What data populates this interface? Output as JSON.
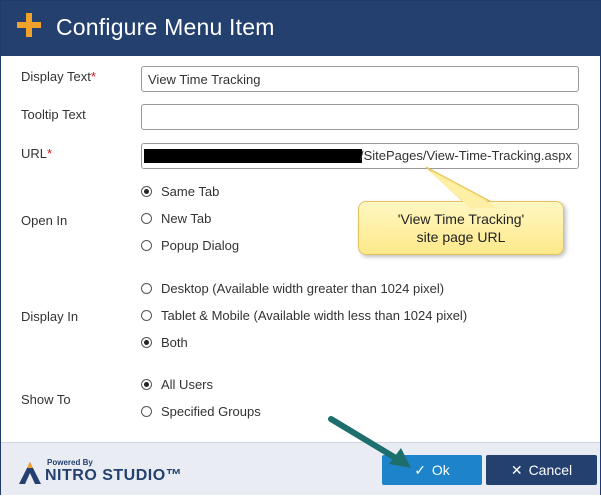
{
  "dialog": {
    "title": "Configure Menu Item"
  },
  "fields": {
    "display_text": {
      "label": "Display Text",
      "required_mark": "*",
      "value": "View Time Tracking"
    },
    "tooltip_text": {
      "label": "Tooltip Text",
      "value": ""
    },
    "url": {
      "label": "URL",
      "required_mark": "*",
      "visible_value": "/SitePages/View-Time-Tracking.aspx"
    }
  },
  "open_in": {
    "label": "Open In",
    "options": [
      {
        "label": "Same Tab",
        "selected": true
      },
      {
        "label": "New Tab",
        "selected": false
      },
      {
        "label": "Popup Dialog",
        "selected": false
      }
    ]
  },
  "display_in": {
    "label": "Display In",
    "options": [
      {
        "label": "Desktop (Available width greater than 1024 pixel)",
        "selected": false
      },
      {
        "label": "Tablet & Mobile (Available width less than 1024 pixel)",
        "selected": false
      },
      {
        "label": "Both",
        "selected": true
      }
    ]
  },
  "show_to": {
    "label": "Show To",
    "options": [
      {
        "label": "All Users",
        "selected": true
      },
      {
        "label": "Specified Groups",
        "selected": false
      }
    ]
  },
  "callout": {
    "line1": "'View Time Tracking'",
    "line2": "site page URL"
  },
  "footer": {
    "powered_by": "Powered By",
    "brand_name": "NITRO STUDIO™",
    "ok_label": "Ok",
    "cancel_label": "Cancel"
  },
  "colors": {
    "header_bg": "#23406f",
    "accent_plus": "#f0a22a",
    "ok_bg": "#1d84cc",
    "cancel_bg": "#23406f",
    "callout_bg": "#fde98a",
    "arrow": "#1f6e6e"
  }
}
